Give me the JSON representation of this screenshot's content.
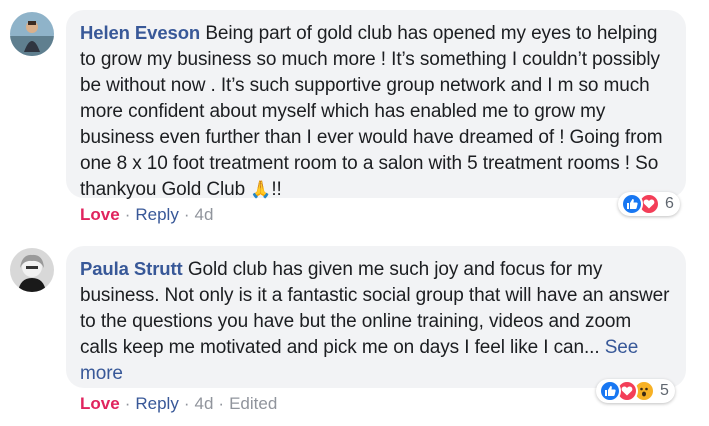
{
  "comments": [
    {
      "author": "Helen Eveson",
      "text": "Being part of gold club has opened my eyes to helping to grow my business so much more ! It’s something I couldn’t possibly be without now . It’s such supportive group network and I m so much more confident about myself which has enabled me to grow my business even further than I ever would have dreamed of ! Going from one 8 x 10 foot treatment room to a salon with 5 treatment rooms ! So thankyou Gold Club",
      "emoji": "🙏",
      "suffix": "!!",
      "reaction_icons": [
        "like-icon",
        "love-icon"
      ],
      "reaction_count": "6",
      "action_love": "Love",
      "action_reply": "Reply",
      "separator": "·",
      "time": "4d"
    },
    {
      "author": "Paula Strutt",
      "text": "Gold club has given me such joy and focus for my business. Not only is it a fantastic social group that will have an answer to the questions you have but the online training, videos and zoom calls keep me motivated and pick me on days I feel like I can...",
      "see_more": "See more",
      "reaction_icons": [
        "like-icon",
        "love-icon",
        "wow-icon"
      ],
      "reaction_count": "5",
      "action_love": "Love",
      "action_reply": "Reply",
      "separator": "·",
      "time": "4d",
      "edited": "Edited"
    }
  ],
  "colors": {
    "author": "#385898",
    "love": "#e0245e",
    "like": "#1877f2",
    "love_react": "#f33e58",
    "wow": "#f7b125",
    "bubble": "#f2f3f5",
    "meta": "#90949c"
  }
}
